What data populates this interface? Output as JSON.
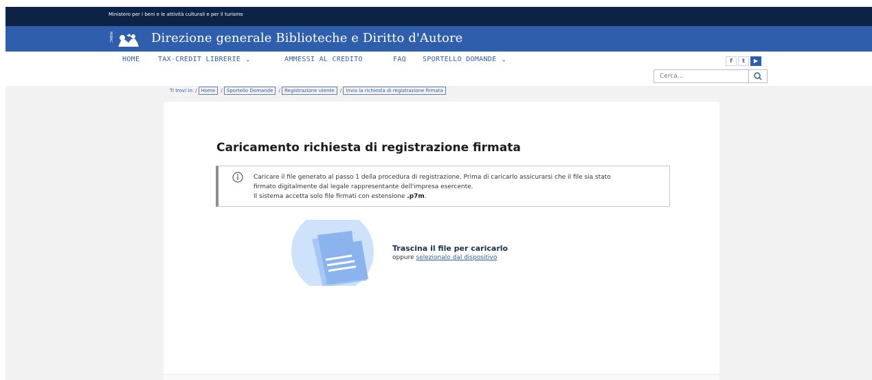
{
  "ministry": "Ministero per i beni e le attività culturali e per il turismo",
  "site_title": "Direzione generale Biblioteche e Diritto d'Autore",
  "logo": {
    "icon": "mibac-logo-icon",
    "text": "MiBAC"
  },
  "nav": [
    {
      "label": "HOME",
      "has_dropdown": false
    },
    {
      "label": "TAX-CREDIT LIBRERIE",
      "has_dropdown": true
    },
    {
      "label": "AMMESSI AL CREDITO",
      "has_dropdown": false
    },
    {
      "label": "FAQ",
      "has_dropdown": false
    },
    {
      "label": "SPORTELLO DOMANDE",
      "has_dropdown": true
    }
  ],
  "social": [
    {
      "icon": "facebook-icon",
      "glyph": "f"
    },
    {
      "icon": "twitter-icon",
      "glyph": "t"
    },
    {
      "icon": "youtube-icon",
      "glyph": "▶"
    }
  ],
  "search": {
    "placeholder": "Cerca...",
    "icon": "search-icon"
  },
  "breadcrumb": {
    "prefix": "Ti trovi in:",
    "items": [
      "Home",
      "Sportello Domande",
      "Registrazione utente",
      "Invia la richiesta di registrazione firmata"
    ]
  },
  "page_title": "Caricamento richiesta di registrazione firmata",
  "info": {
    "icon": "info-icon",
    "line1": "Caricare il file generato al passo 1 della procedura di registrazione. Prima di caricarlo assicurarsi che il file sia stato",
    "line2": "firmato digitalmente dal legale rappresentante dell'impresa esercente.",
    "line3_prefix": "Il sistema accetta solo file firmati con estensione ",
    "line3_ext": ".p7m",
    "line3_suffix": "."
  },
  "upload": {
    "icon": "document-upload-icon",
    "title": "Trascina il file per caricarlo",
    "sub_prefix": "oppure ",
    "sub_link": "selezionalo dal dispositivo"
  },
  "colors": {
    "dark_bar": "#0d2345",
    "header_blue": "#2e5eac",
    "page_grey": "#f2f2f2"
  }
}
